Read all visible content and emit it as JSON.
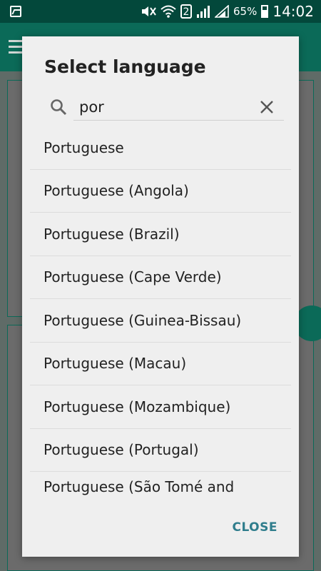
{
  "status_bar": {
    "sim_slot": "2",
    "battery_percent": "65%",
    "time": "14:02",
    "icons": [
      "image-icon",
      "mute-icon",
      "wifi-icon",
      "signal-icon",
      "battery-icon"
    ]
  },
  "dialog": {
    "title": "Select language",
    "search": {
      "value": "por",
      "icon": "search-icon",
      "clear_icon": "close-icon"
    },
    "languages": [
      "Portuguese",
      "Portuguese (Angola)",
      "Portuguese (Brazil)",
      "Portuguese (Cape Verde)",
      "Portuguese (Guinea-Bissau)",
      "Portuguese (Macau)",
      "Portuguese (Mozambique)",
      "Portuguese (Portugal)",
      "Portuguese (São Tomé and Príncipe)"
    ],
    "close_label": "CLOSE"
  },
  "colors": {
    "accent": "#2f7d8c",
    "app_primary": "#0b6a58",
    "status_bar": "#03483b",
    "dialog_bg": "#efefef"
  }
}
